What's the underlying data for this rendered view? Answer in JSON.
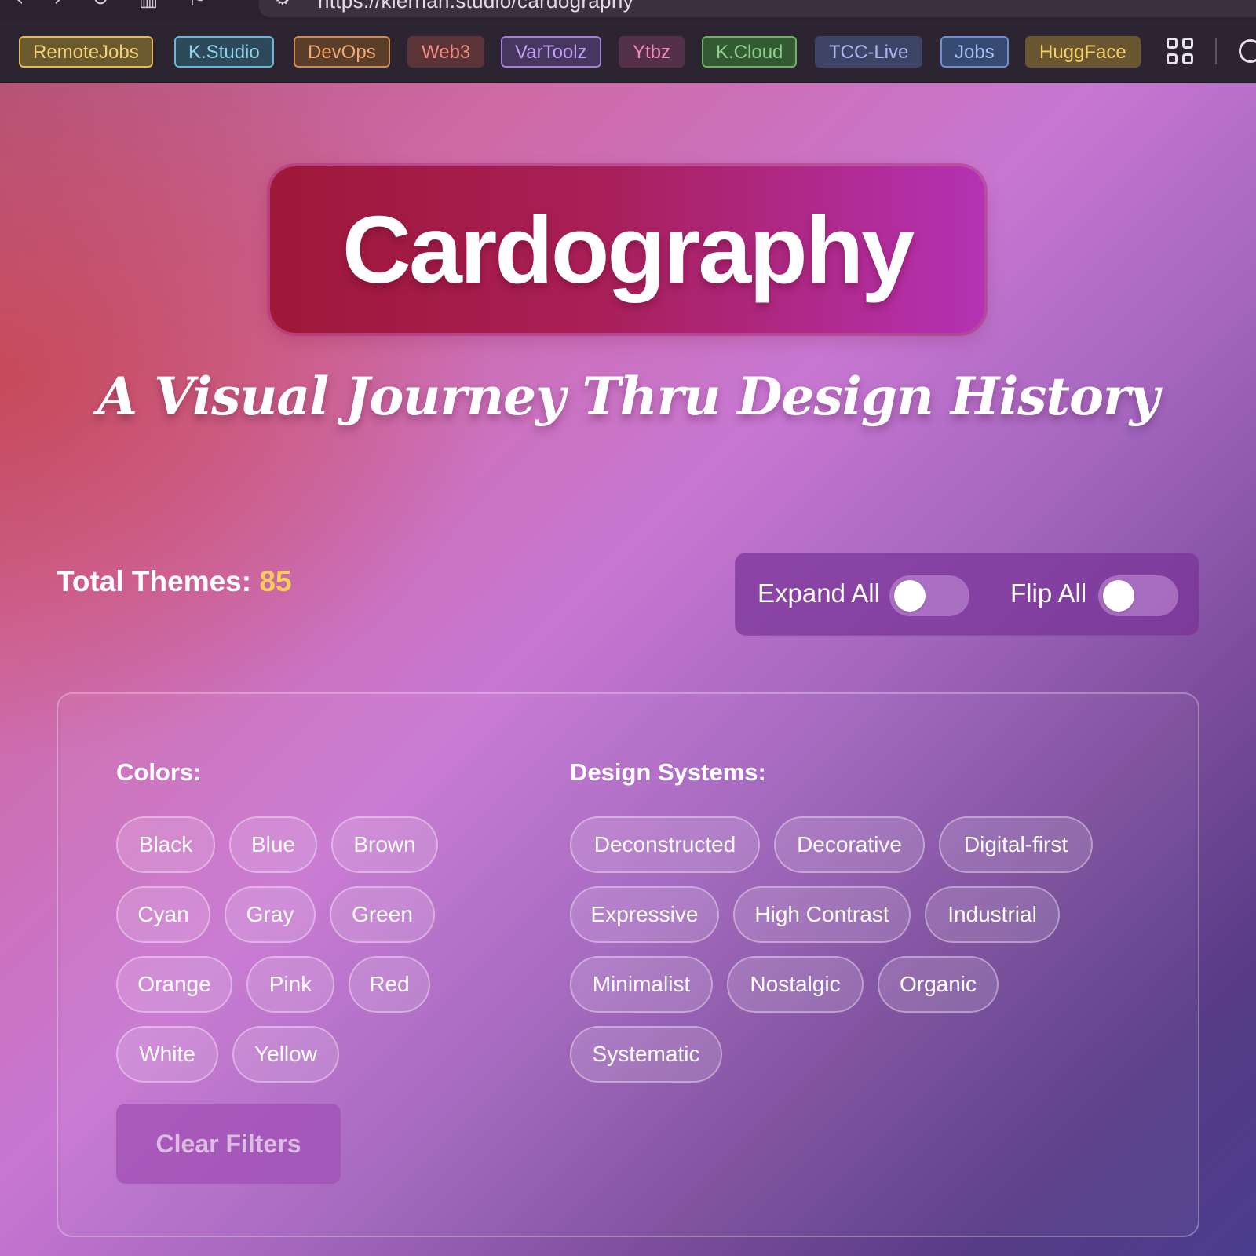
{
  "browser": {
    "url": "https://kiernan.studio/cardography",
    "nav_icons": [
      "back-icon",
      "forward-icon",
      "reload-icon",
      "library-icon",
      "bookmark-icon"
    ],
    "bookmarks": [
      {
        "label": "RemoteJobs",
        "color": "#f4d27a",
        "bg": "#6a5a2e",
        "border": "#e3bd54"
      },
      {
        "label": "K.Studio",
        "color": "#8fd0ea",
        "bg": "#2e4a5a",
        "border": "#6ab6d6"
      },
      {
        "label": "DevOps",
        "color": "#f2a870",
        "bg": "#5a3e2a",
        "border": "#d38b55"
      },
      {
        "label": "Web3",
        "color": "#f08a83",
        "bg": "#5a3436",
        "border": "#5a3436"
      },
      {
        "label": "VarToolz",
        "color": "#c6a0f2",
        "bg": "#463660",
        "border": "#a47fd6"
      },
      {
        "label": "Ytbz",
        "color": "#f08ab6",
        "bg": "#55304a",
        "border": "#55304a"
      },
      {
        "label": "K.Cloud",
        "color": "#8ed08a",
        "bg": "#345a34",
        "border": "#6ab266"
      },
      {
        "label": "TCC-Live",
        "color": "#a9b6f0",
        "bg": "#3e4466",
        "border": "#3e4466"
      },
      {
        "label": "Jobs",
        "color": "#a9c0f4",
        "bg": "#374a72",
        "border": "#6f8ed8"
      },
      {
        "label": "HuggFace",
        "color": "#f6d06a",
        "bg": "#6a5630",
        "border": "#6a5630"
      }
    ]
  },
  "header": {
    "title": "Cardography",
    "subtitle": "A Visual Journey Thru Design History"
  },
  "stats": {
    "total_label": "Total Themes:",
    "total_value": "85"
  },
  "toggles": {
    "expand_label": "Expand All",
    "flip_label": "Flip All",
    "expand_on": false,
    "flip_on": false
  },
  "filters": {
    "colors_heading": "Colors:",
    "colors": [
      "Black",
      "Blue",
      "Brown",
      "Cyan",
      "Gray",
      "Green",
      "Orange",
      "Pink",
      "Red",
      "White",
      "Yellow"
    ],
    "systems_heading": "Design Systems:",
    "systems": [
      "Deconstructed",
      "Decorative",
      "Digital-first",
      "Expressive",
      "High Contrast",
      "Industrial",
      "Minimalist",
      "Nostalgic",
      "Organic",
      "Systematic"
    ],
    "clear_label": "Clear Filters"
  },
  "theme_colors": {
    "accent_number": "#f6cc5a",
    "title_gradient_start": "#9e1838",
    "title_gradient_end": "#b432b4"
  }
}
